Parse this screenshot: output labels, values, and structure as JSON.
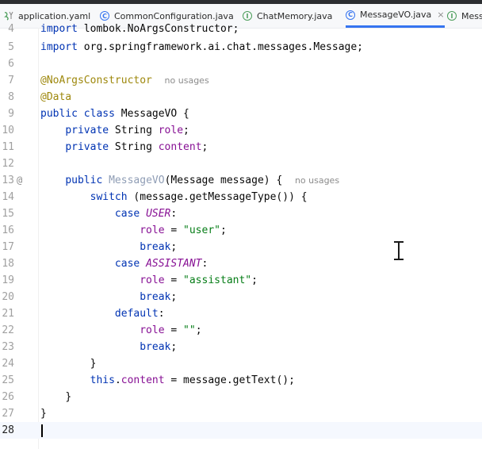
{
  "tabs": [
    {
      "label": "application.yaml",
      "icon": "yaml-file-icon"
    },
    {
      "label": "CommonConfiguration.java",
      "icon": "class-icon"
    },
    {
      "label": "ChatMemory.java",
      "icon": "interface-icon"
    },
    {
      "label": "MessageVO.java",
      "icon": "class-icon",
      "active": true,
      "close": "×"
    },
    {
      "label": "Mess",
      "icon": "interface-icon"
    }
  ],
  "icon_glyphs": {
    "class": "C",
    "interface": "I"
  },
  "colors": {
    "keyword": "#0033b3",
    "annotation": "#9e880d",
    "string": "#067d17",
    "field": "#871094",
    "active_tab_underline": "#3574f0"
  },
  "editor": {
    "line_numbers": [
      "4",
      "5",
      "6",
      "7",
      "8",
      "9",
      "10",
      "11",
      "12",
      "13",
      "14",
      "15",
      "16",
      "17",
      "18",
      "19",
      "20",
      "21",
      "22",
      "23",
      "24",
      "25",
      "26",
      "27",
      "28"
    ],
    "gutter_marker": "@",
    "hint_no_usages": "no usages",
    "line4": {
      "kw": "import",
      "rest": " lombok.NoArgsConstructor;"
    },
    "line5": {
      "kw": "import",
      "rest": " org.springframework.ai.chat.messages.Message;"
    },
    "line7": {
      "ann": "@NoArgsConstructor"
    },
    "line8": {
      "ann": "@Data"
    },
    "line9": {
      "kw1": "public",
      "kw2": "class",
      "name": " MessageVO {"
    },
    "line10": {
      "kw": "private",
      "type": " String ",
      "field": "role",
      "end": ";"
    },
    "line11": {
      "kw": "private",
      "type": " String ",
      "field": "content",
      "end": ";"
    },
    "line13": {
      "kw": "public",
      "ctor": "MessageVO",
      "rest": "(Message message) {"
    },
    "line14": {
      "kw": "switch",
      "rest": " (message.getMessageType()) {"
    },
    "line15": {
      "kw": "case",
      "enum": "USER",
      "end": ":"
    },
    "line16": {
      "field": "role",
      "op": " = ",
      "str": "\"user\"",
      "end": ";"
    },
    "line17": {
      "kw": "break",
      "end": ";"
    },
    "line18": {
      "kw": "case",
      "enum": "ASSISTANT",
      "end": ":"
    },
    "line19": {
      "field": "role",
      "op": " = ",
      "str": "\"assistant\"",
      "end": ";"
    },
    "line20": {
      "kw": "break",
      "end": ";"
    },
    "line21": {
      "kw": "default",
      "end": ":"
    },
    "line22": {
      "field": "role",
      "op": " = ",
      "str": "\"\"",
      "end": ";"
    },
    "line23": {
      "kw": "break",
      "end": ";"
    },
    "line24": {
      "text": "}"
    },
    "line25": {
      "kw": "this",
      "dot": ".",
      "field": "content",
      "rest": " = message.getText();"
    },
    "line26": {
      "text": "}"
    },
    "line27": {
      "text": "}"
    }
  }
}
